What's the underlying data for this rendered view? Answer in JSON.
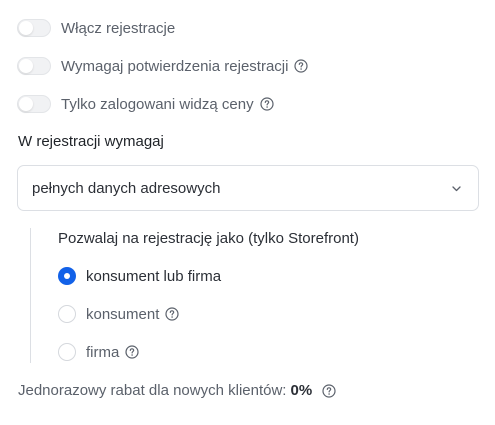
{
  "toggles": [
    {
      "label": "Włącz rejestracje",
      "on": false,
      "help": false
    },
    {
      "label": "Wymagaj potwierdzenia rejestracji",
      "on": false,
      "help": true
    },
    {
      "label": "Tylko zalogowani widzą ceny",
      "on": false,
      "help": true
    }
  ],
  "registration": {
    "title": "W rejestracji wymagaj",
    "select_value": "pełnych danych adresowych"
  },
  "register_as": {
    "title": "Pozwalaj na rejestrację jako (tylko Storefront)",
    "options": [
      {
        "label": "konsument lub firma",
        "checked": true,
        "help": false
      },
      {
        "label": "konsument",
        "checked": false,
        "help": true
      },
      {
        "label": "firma",
        "checked": false,
        "help": true
      }
    ]
  },
  "discount": {
    "label": "Jednorazowy rabat dla nowych klientów:",
    "value": "0%"
  },
  "colors": {
    "accent": "#1261e8",
    "border": "#dcdfe4",
    "muted_text": "#5b616b"
  },
  "icons": {
    "help": "question-circle-icon",
    "chevron": "chevron-down-icon"
  }
}
